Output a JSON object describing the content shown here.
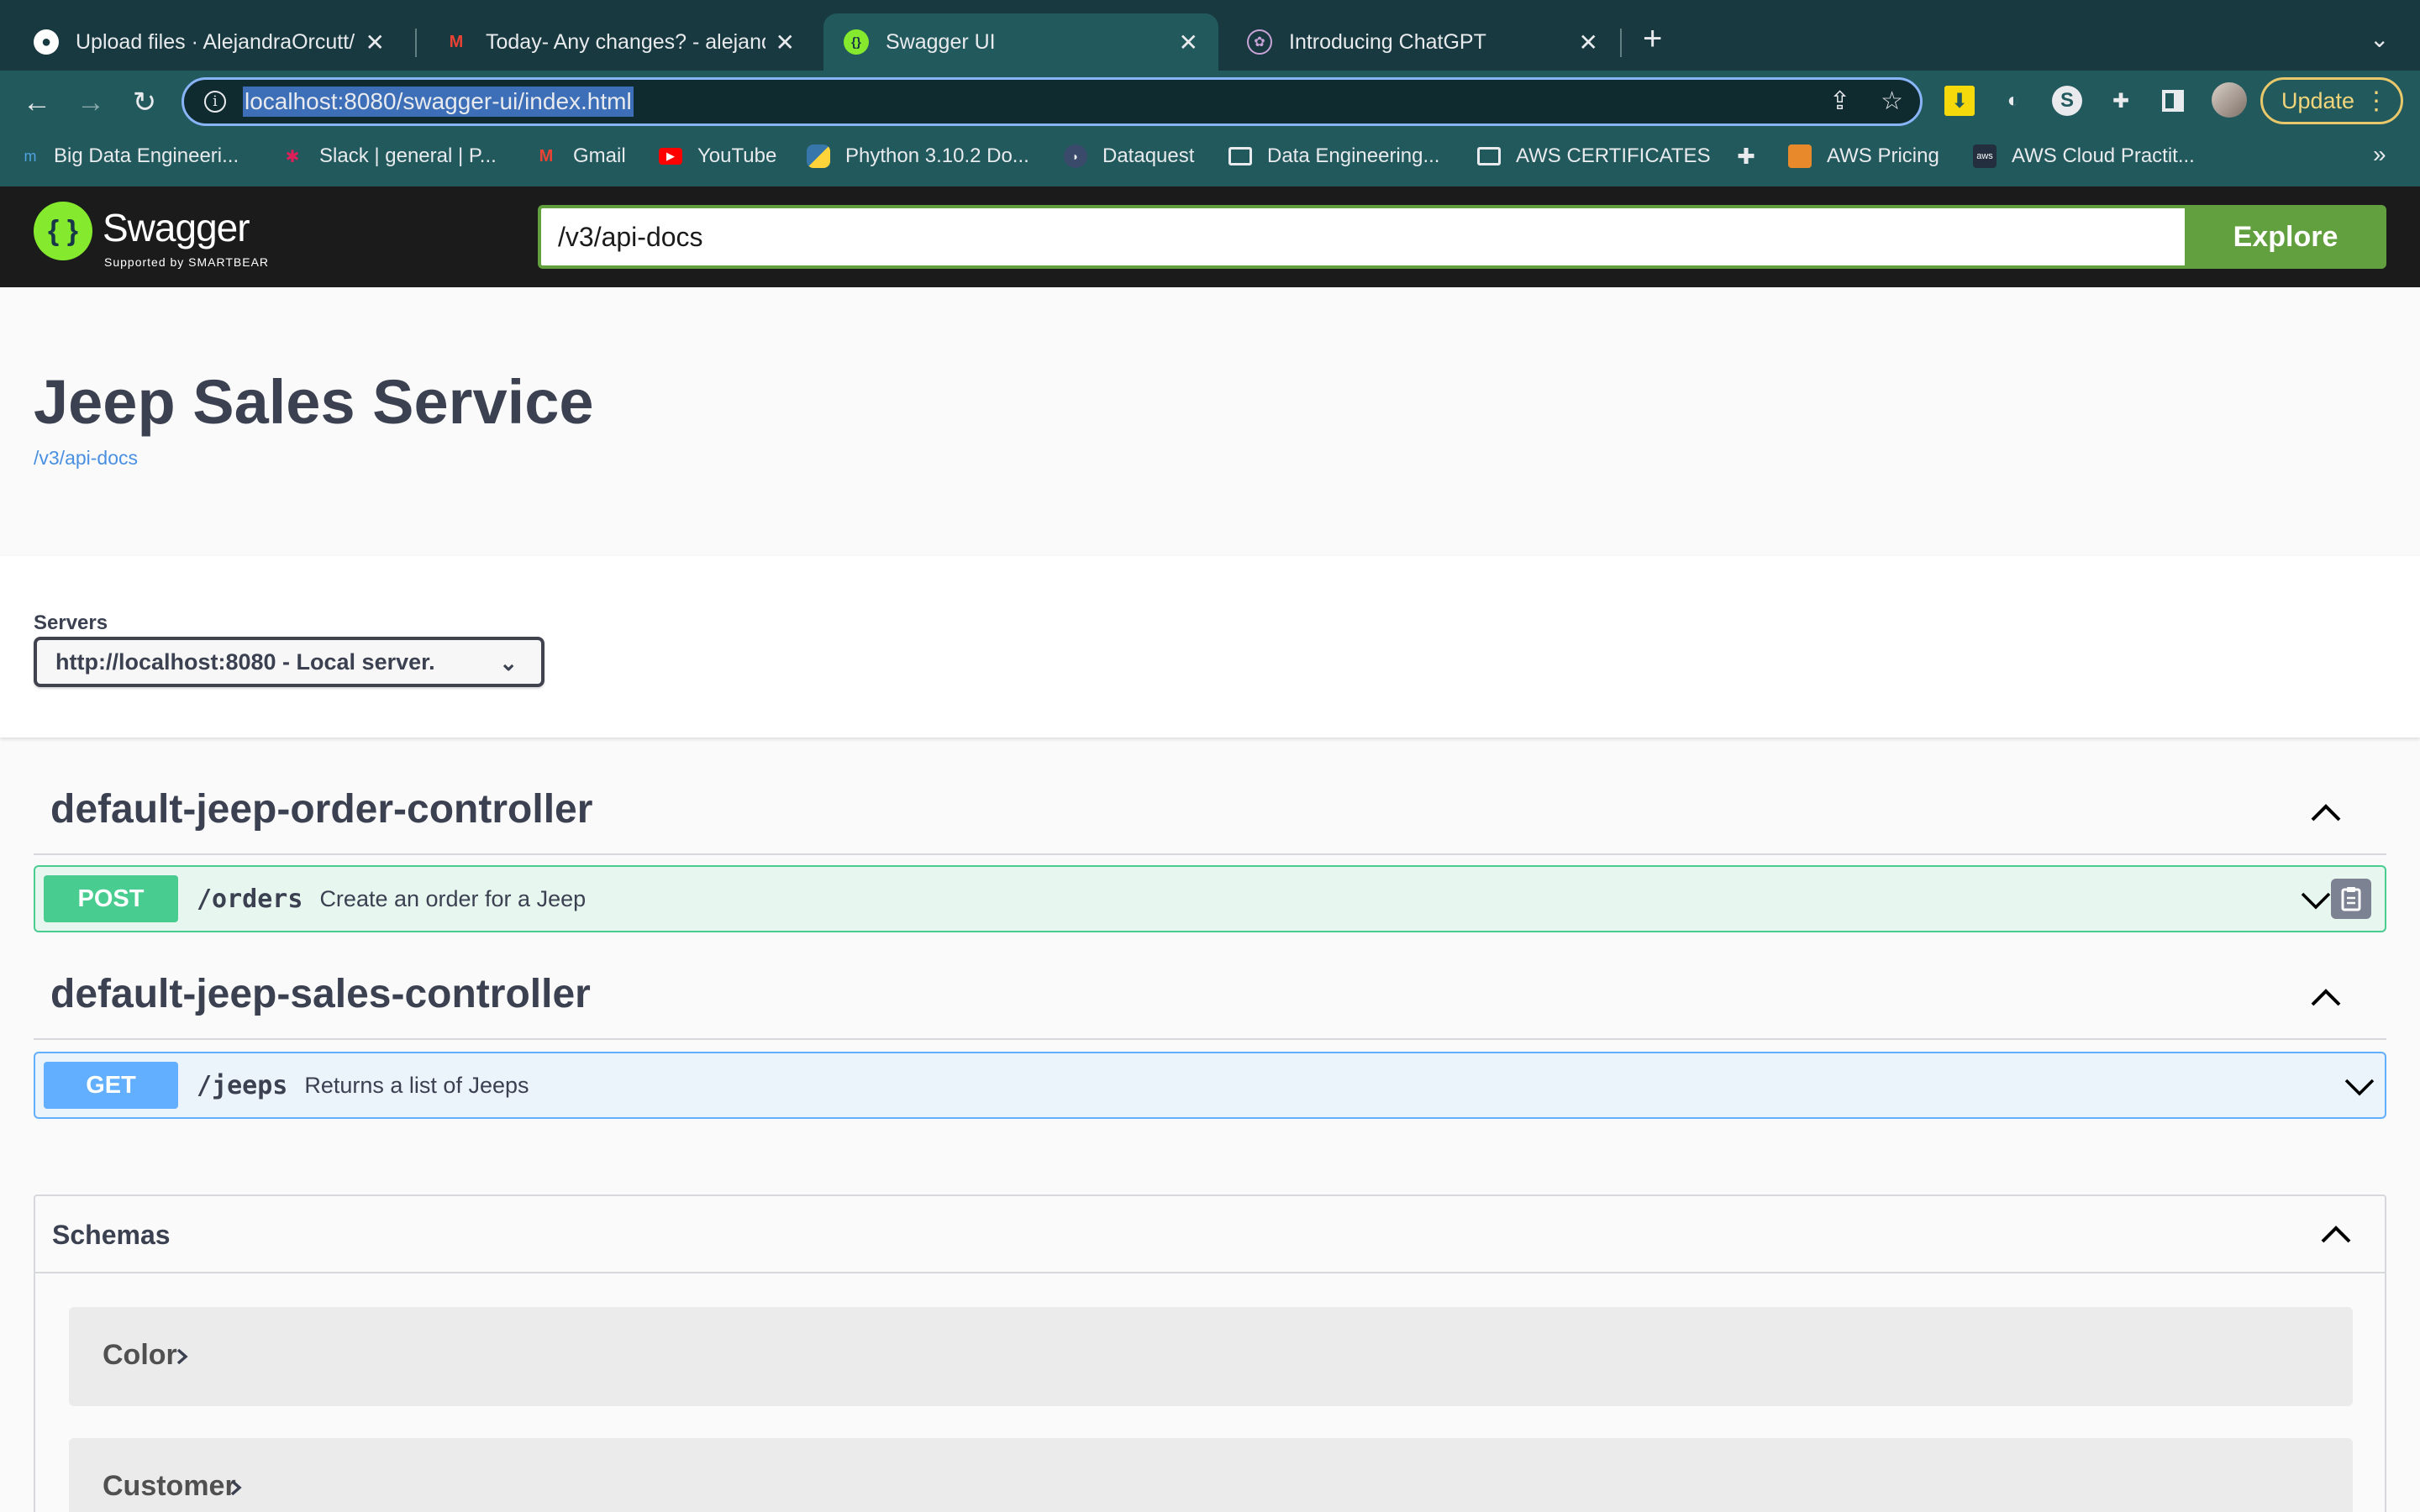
{
  "browser": {
    "tabs": [
      {
        "title": "Upload files · AlejandraOrcutt/L",
        "icon": "github-icon",
        "active": false
      },
      {
        "title": "Today- Any changes? - alejand",
        "icon": "gmail-icon",
        "active": false
      },
      {
        "title": "Swagger UI",
        "icon": "swagger-icon",
        "active": true
      },
      {
        "title": "Introducing ChatGPT",
        "icon": "openai-icon",
        "active": false
      }
    ],
    "new_tab": "+",
    "address": "localhost:8080/swagger-ui/index.html",
    "update_label": "Update",
    "bookmarks": [
      {
        "label": "Big Data Engineeri...",
        "icon": "m-icon"
      },
      {
        "label": "Slack | general | P...",
        "icon": "slack-icon"
      },
      {
        "label": "Gmail",
        "icon": "gmail-icon"
      },
      {
        "label": "YouTube",
        "icon": "youtube-icon"
      },
      {
        "label": "Phython 3.10.2 Do...",
        "icon": "python-icon"
      },
      {
        "label": "Dataquest",
        "icon": "dataquest-icon"
      },
      {
        "label": "Data Engineering...",
        "icon": "folder-icon"
      },
      {
        "label": "AWS CERTIFICATES",
        "icon": "folder-icon"
      },
      {
        "label": "",
        "icon": "puzzle-icon"
      },
      {
        "label": "AWS Pricing",
        "icon": "aws-cube-icon"
      },
      {
        "label": "AWS Cloud Practit...",
        "icon": "aws-icon"
      }
    ],
    "bookmarks_more": "»"
  },
  "swagger": {
    "brand": "Swagger",
    "brand_sub": "Supported by SMARTBEAR",
    "url_value": "/v3/api-docs",
    "explore_label": "Explore"
  },
  "info": {
    "title": "Jeep Sales Service",
    "link": "/v3/api-docs"
  },
  "servers": {
    "label": "Servers",
    "selected": "http://localhost:8080 - Local server."
  },
  "controllers": [
    {
      "name": "default-jeep-order-controller",
      "operation": {
        "method": "POST",
        "path": "/orders",
        "summary": "Create an order for a Jeep"
      }
    },
    {
      "name": "default-jeep-sales-controller",
      "operation": {
        "method": "GET",
        "path": "/jeeps",
        "summary": "Returns a list of Jeeps"
      }
    }
  ],
  "schemas": {
    "title": "Schemas",
    "models": [
      "Color",
      "Customer"
    ]
  },
  "colors": {
    "post": "#49cc90",
    "get": "#61affe",
    "swagger_green": "#85ea2d",
    "explore_green": "#62a03f"
  }
}
